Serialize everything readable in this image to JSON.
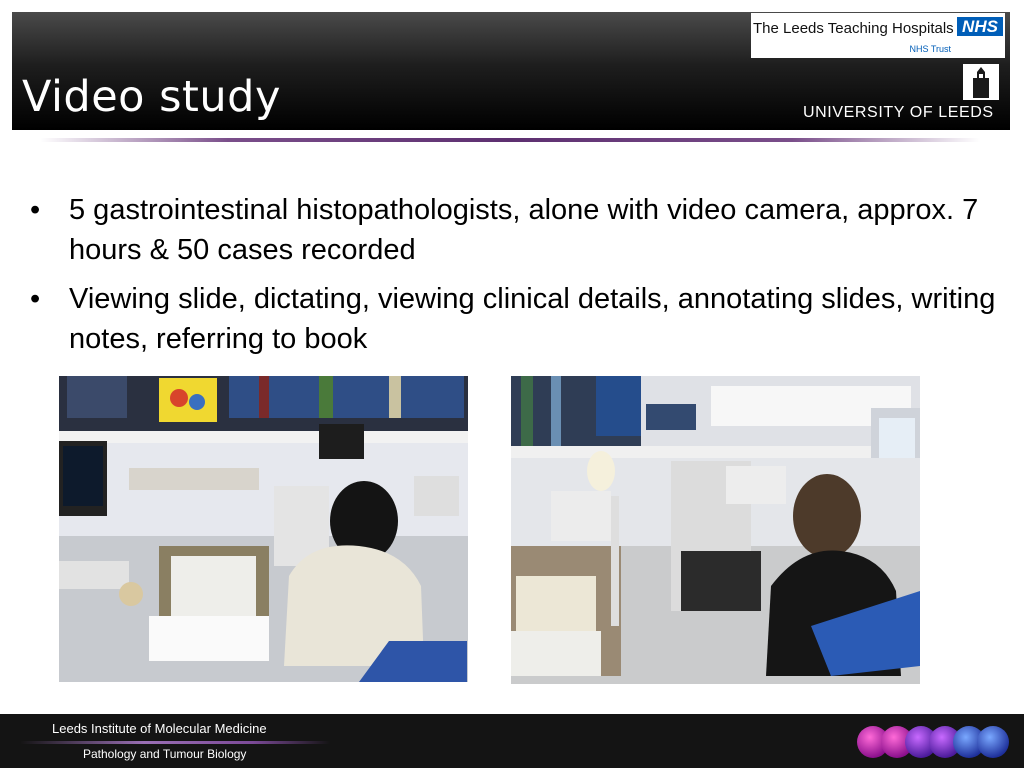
{
  "slide": {
    "title": "Video study",
    "bullets": [
      "5 gastrointestinal histopathologists, alone with video camera, approx. 7 hours & 50 cases recorded",
      "Viewing slide, dictating, viewing clinical details, annotating slides, writing notes, referring to book"
    ],
    "bullet_symbol": "•"
  },
  "logos": {
    "nhs_name": "The Leeds Teaching Hospitals",
    "nhs_badge": "NHS",
    "nhs_trust": "NHS Trust",
    "university": "UNIVERSITY OF LEEDS"
  },
  "footer": {
    "line1": "Leeds Institute of Molecular Medicine",
    "line2": "Pathology and Tumour Biology"
  },
  "colors": {
    "header": "#000000",
    "nhs_blue": "#005eb8",
    "divider_purple": "#5d2f70",
    "footer": "#141414"
  }
}
